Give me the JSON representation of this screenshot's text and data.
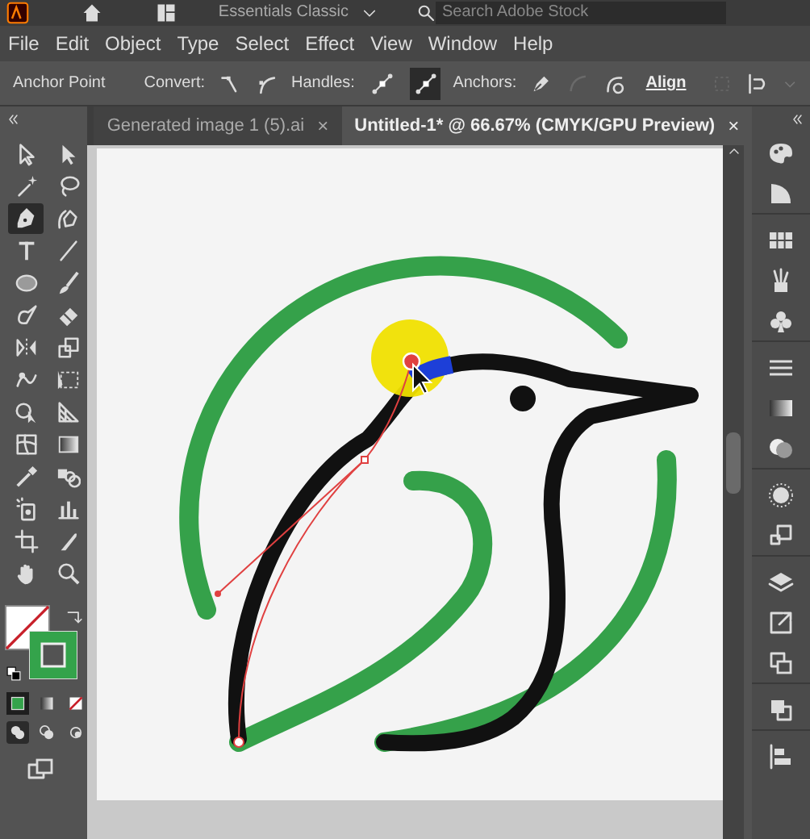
{
  "top_bar": {
    "workspace": "Essentials Classic",
    "search": {
      "placeholder": "Search Adobe Stock"
    }
  },
  "menu": [
    "File",
    "Edit",
    "Object",
    "Type",
    "Select",
    "Effect",
    "View",
    "Window",
    "Help"
  ],
  "control_bar": {
    "label": "Anchor Point",
    "convert_label": "Convert:",
    "handles_label": "Handles:",
    "handles": [
      {
        "selected": false
      },
      {
        "selected": true
      }
    ],
    "anchors_label": "Anchors:",
    "align": "Align"
  },
  "tabs": [
    {
      "label": "Generated image 1 (5).ai",
      "close": "×",
      "selected": false
    },
    {
      "label": "Untitled-1* @ 66.67% (CMYK/GPU Preview)",
      "close": "×",
      "selected": true
    }
  ],
  "tools": [
    {
      "selected": false
    },
    {
      "selected": false
    },
    {
      "selected": false
    },
    {
      "selected": false
    },
    {
      "selected": true
    },
    {
      "selected": false
    },
    {
      "selected": false
    },
    {
      "selected": false
    },
    {
      "selected": false
    },
    {
      "selected": false
    },
    {
      "selected": false
    },
    {
      "selected": false
    },
    {
      "selected": false
    },
    {
      "selected": false
    },
    {
      "selected": false
    },
    {
      "selected": false
    },
    {
      "selected": false
    },
    {
      "selected": false
    },
    {
      "selected": false
    },
    {
      "selected": false
    },
    {
      "selected": false
    },
    {
      "selected": false
    },
    {
      "selected": false
    },
    {
      "selected": false
    },
    {
      "selected": false
    },
    {
      "selected": false
    },
    {
      "selected": false
    },
    {
      "selected": false
    }
  ]
}
